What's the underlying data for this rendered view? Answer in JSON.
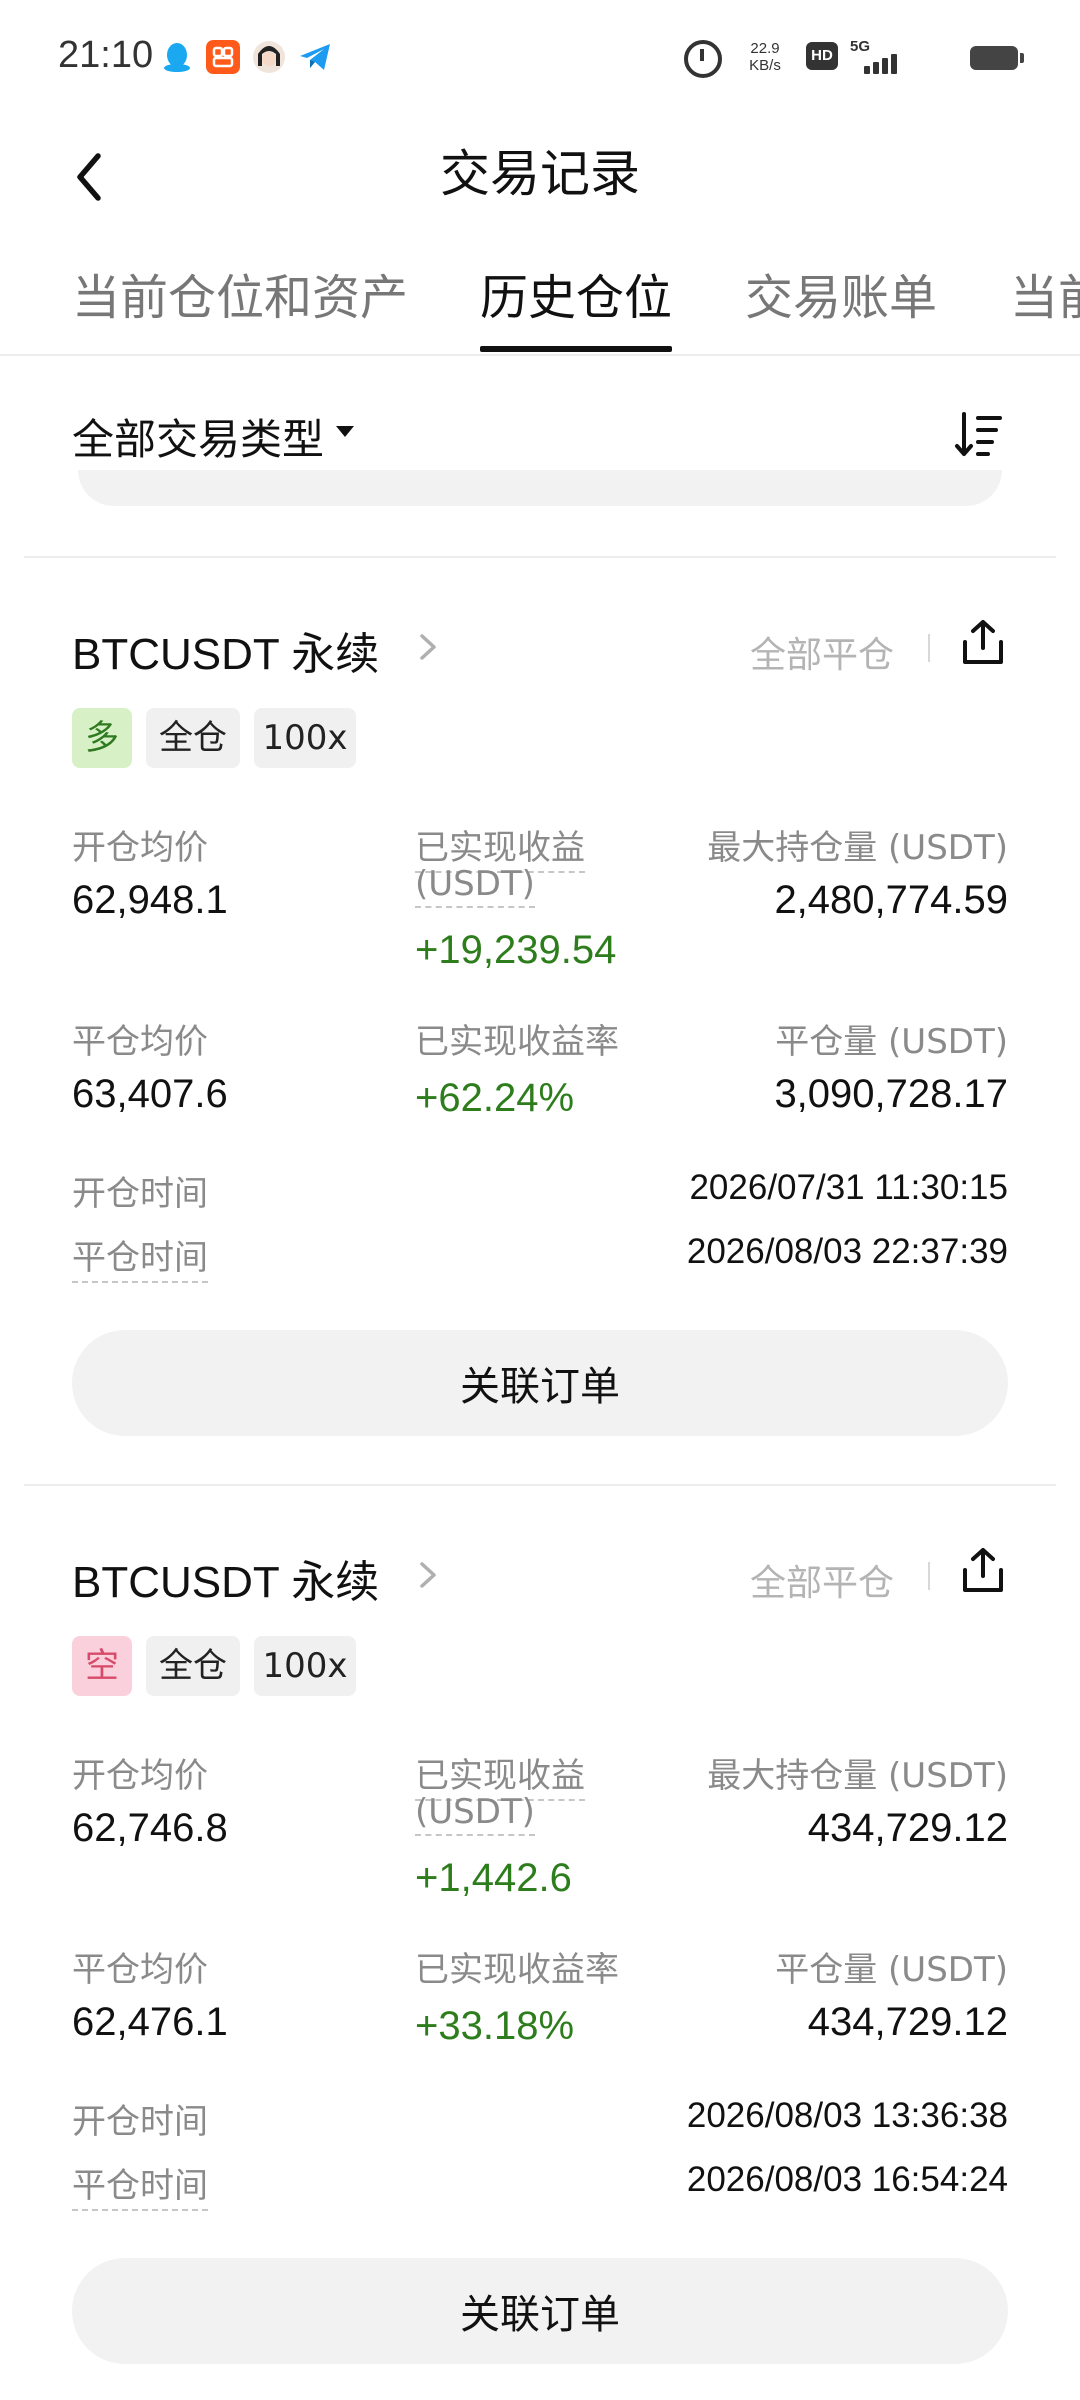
{
  "status_bar": {
    "time": "21:10",
    "net_speed_value": "22.9",
    "net_speed_unit": "KB/s",
    "hd_badge": "HD",
    "network": "5G",
    "app_icons": [
      "qq-icon",
      "taobao-icon",
      "avatar-icon",
      "telegram-icon"
    ]
  },
  "header": {
    "title": "交易记录"
  },
  "tabs": [
    {
      "label": "当前仓位和资产",
      "active": false
    },
    {
      "label": "历史仓位",
      "active": true
    },
    {
      "label": "交易账单",
      "active": false
    },
    {
      "label": "当前",
      "active": false
    }
  ],
  "filter": {
    "label": "全部交易类型"
  },
  "positions": [
    {
      "symbol": "BTCUSDT 永续",
      "close_status": "全部平仓",
      "side": "多",
      "margin_mode": "全仓",
      "leverage": "100x",
      "labels": {
        "open_avg": "开仓均价",
        "realized_pnl_line1": "已实现收益",
        "realized_pnl_line2": "(USDT)",
        "max_pos": "最大持仓量 (USDT)",
        "close_avg": "平仓均价",
        "realized_pnl_rate": "已实现收益率",
        "close_vol": "平仓量 (USDT)",
        "open_time": "开仓时间",
        "close_time": "平仓时间"
      },
      "open_avg": "62,948.1",
      "realized_pnl": "+19,239.54",
      "max_pos": "2,480,774.59",
      "close_avg": "63,407.6",
      "realized_pnl_rate": "+62.24%",
      "close_vol": "3,090,728.17",
      "open_time": "2026/07/31 11:30:15",
      "close_time": "2026/08/03 22:37:39",
      "button": "关联订单"
    },
    {
      "symbol": "BTCUSDT 永续",
      "close_status": "全部平仓",
      "side": "空",
      "margin_mode": "全仓",
      "leverage": "100x",
      "labels": {
        "open_avg": "开仓均价",
        "realized_pnl_line1": "已实现收益",
        "realized_pnl_line2": "(USDT)",
        "max_pos": "最大持仓量 (USDT)",
        "close_avg": "平仓均价",
        "realized_pnl_rate": "已实现收益率",
        "close_vol": "平仓量 (USDT)",
        "open_time": "开仓时间",
        "close_time": "平仓时间"
      },
      "open_avg": "62,746.8",
      "realized_pnl": "+1,442.6",
      "max_pos": "434,729.12",
      "close_avg": "62,476.1",
      "realized_pnl_rate": "+33.18%",
      "close_vol": "434,729.12",
      "open_time": "2026/08/03 13:36:38",
      "close_time": "2026/08/03 16:54:24",
      "button": "关联订单"
    }
  ],
  "colors": {
    "profit_green": "#2e7d1c",
    "long_tag_bg": "#d7f0c6",
    "short_tag_bg": "#fad0dc",
    "muted_text": "#8a8a8a"
  }
}
